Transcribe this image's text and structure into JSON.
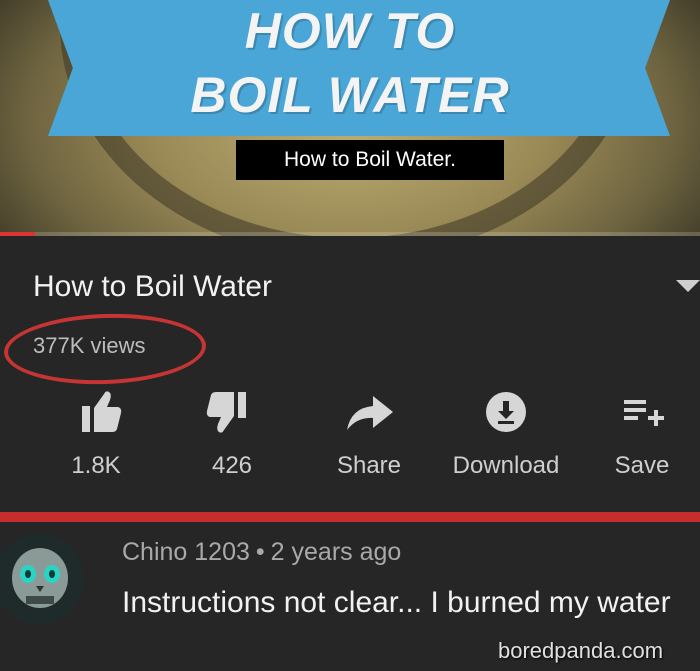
{
  "video": {
    "thumbnail_title_line1": "HOW TO",
    "thumbnail_title_line2": "BOIL WATER",
    "caption": "How to Boil Water.",
    "progress_fraction": 0.05,
    "colors": {
      "banner": "#4aa6d6",
      "progress": "#d33333"
    }
  },
  "info": {
    "title": "How to Boil Water",
    "views": "377K views",
    "annotation_color": "#c73434"
  },
  "actions": [
    {
      "id": "like",
      "icon": "thumbs-up-icon",
      "label": "1.8K"
    },
    {
      "id": "dislike",
      "icon": "thumbs-down-icon",
      "label": "426"
    },
    {
      "id": "share",
      "icon": "share-arrow-icon",
      "label": "Share"
    },
    {
      "id": "download",
      "icon": "download-icon",
      "label": "Download"
    },
    {
      "id": "save",
      "icon": "add-to-playlist-icon",
      "label": "Save"
    }
  ],
  "comment": {
    "author": "Chino 1203",
    "separator": "•",
    "time": "2 years ago",
    "text": "Instructions not clear... I burned my water",
    "avatar_icon": "skull-avatar-icon"
  },
  "watermark": "boredpanda.com"
}
